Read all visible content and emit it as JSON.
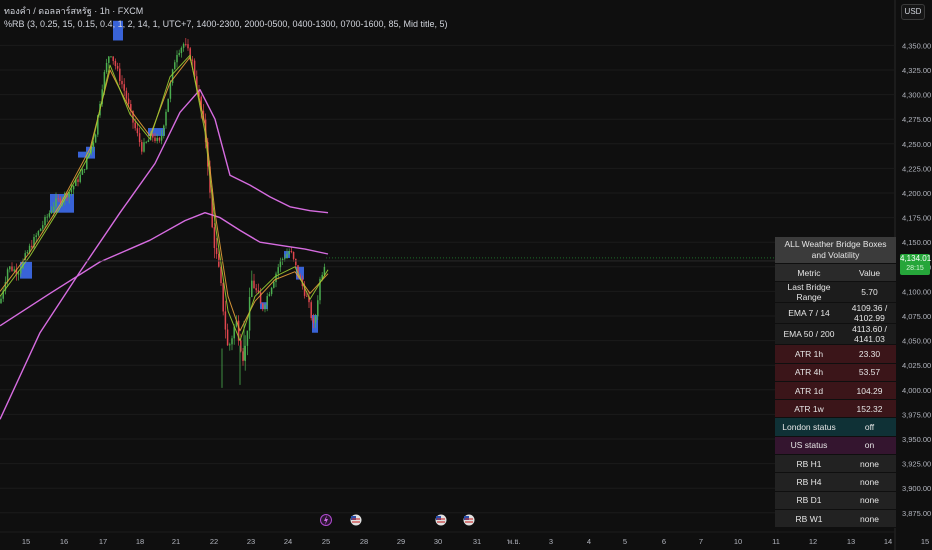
{
  "header": {
    "symbol_line": "ทองคำ / ดอลลาร์สหรัฐ · 1h · FXCM",
    "indicator_line": "%RB (3, 0.25, 15, 0.15, 0.4, 1, 2, 14, 1, UTC+7, 1400-2300, 2000-0500, 0400-1300, 0700-1600, 85, Mid title, 5)"
  },
  "currency_button": "USD",
  "last_price": {
    "value": "4,134.01",
    "countdown": "28:15"
  },
  "chart_data": {
    "type": "candlestick",
    "title": "",
    "y_axis": {
      "min": 3870,
      "max": 4375,
      "ticks": [
        4350,
        4325,
        4300,
        4275,
        4250,
        4225,
        4200,
        4175,
        4150,
        4125,
        4100,
        4075,
        4050,
        4025,
        4000,
        3975,
        3950,
        3925,
        3900,
        3875
      ],
      "tick_labels": [
        "4,350.00",
        "4,325.00",
        "4,300.00",
        "4,275.00",
        "4,250.00",
        "4,225.00",
        "4,200.00",
        "4,175.00",
        "4,150.00",
        "4,125.00",
        "4,100.00",
        "4,075.00",
        "4,050.00",
        "4,025.00",
        "4,000.00",
        "3,975.00",
        "3,950.00",
        "3,925.00",
        "3,900.00",
        "3,875.00"
      ]
    },
    "x_axis": {
      "labels": [
        "15",
        "16",
        "17",
        "18",
        "21",
        "22",
        "23",
        "24",
        "25",
        "28",
        "29",
        "30",
        "31",
        "พ.ย.",
        "3",
        "4",
        "5",
        "6",
        "7",
        "10",
        "11",
        "12",
        "13",
        "14",
        "15"
      ]
    },
    "ohlc_path": [
      [
        0,
        4088
      ],
      [
        8,
        4125
      ],
      [
        18,
        4120
      ],
      [
        30,
        4145
      ],
      [
        45,
        4172
      ],
      [
        55,
        4190
      ],
      [
        70,
        4202
      ],
      [
        82,
        4220
      ],
      [
        95,
        4258
      ],
      [
        103,
        4315
      ],
      [
        110,
        4345
      ],
      [
        118,
        4322
      ],
      [
        125,
        4302
      ],
      [
        132,
        4275
      ],
      [
        142,
        4245
      ],
      [
        152,
        4258
      ],
      [
        160,
        4250
      ],
      [
        168,
        4296
      ],
      [
        176,
        4342
      ],
      [
        184,
        4352
      ],
      [
        192,
        4335
      ],
      [
        200,
        4290
      ],
      [
        207,
        4245
      ],
      [
        212,
        4165
      ],
      [
        220,
        4112
      ],
      [
        228,
        4040
      ],
      [
        236,
        4070
      ],
      [
        244,
        4030
      ],
      [
        252,
        4112
      ],
      [
        262,
        4082
      ],
      [
        270,
        4102
      ],
      [
        280,
        4130
      ],
      [
        290,
        4142
      ],
      [
        300,
        4112
      ],
      [
        308,
        4090
      ],
      [
        314,
        4062
      ],
      [
        320,
        4112
      ],
      [
        326,
        4134
      ]
    ],
    "series": [
      {
        "name": "",
        "color": "#d66ce0",
        "points": [
          [
            0,
            3970
          ],
          [
            40,
            4058
          ],
          [
            80,
            4120
          ],
          [
            120,
            4180
          ],
          [
            155,
            4230
          ],
          [
            180,
            4282
          ],
          [
            200,
            4305
          ],
          [
            215,
            4275
          ],
          [
            230,
            4218
          ],
          [
            250,
            4208
          ],
          [
            270,
            4196
          ],
          [
            290,
            4186
          ],
          [
            310,
            4182
          ],
          [
            328,
            4180
          ]
        ]
      },
      {
        "name": "",
        "color": "#d66ce0",
        "points": [
          [
            0,
            4065
          ],
          [
            50,
            4098
          ],
          [
            100,
            4130
          ],
          [
            150,
            4152
          ],
          [
            185,
            4172
          ],
          [
            205,
            4180
          ],
          [
            220,
            4175
          ],
          [
            240,
            4162
          ],
          [
            260,
            4150
          ],
          [
            285,
            4146
          ],
          [
            305,
            4143
          ],
          [
            328,
            4138
          ]
        ]
      },
      {
        "name": "",
        "color": "#e8a03a",
        "points": [
          [
            0,
            4100
          ],
          [
            30,
            4140
          ],
          [
            60,
            4188
          ],
          [
            90,
            4245
          ],
          [
            110,
            4325
          ],
          [
            130,
            4285
          ],
          [
            150,
            4258
          ],
          [
            170,
            4312
          ],
          [
            190,
            4338
          ],
          [
            205,
            4270
          ],
          [
            215,
            4180
          ],
          [
            228,
            4095
          ],
          [
            240,
            4060
          ],
          [
            255,
            4090
          ],
          [
            275,
            4112
          ],
          [
            295,
            4120
          ],
          [
            310,
            4098
          ],
          [
            328,
            4118
          ]
        ]
      },
      {
        "name": "",
        "color": "#9acd32",
        "points": [
          [
            0,
            4095
          ],
          [
            30,
            4136
          ],
          [
            60,
            4185
          ],
          [
            90,
            4240
          ],
          [
            110,
            4330
          ],
          [
            130,
            4280
          ],
          [
            150,
            4255
          ],
          [
            170,
            4318
          ],
          [
            190,
            4340
          ],
          [
            205,
            4262
          ],
          [
            215,
            4170
          ],
          [
            228,
            4080
          ],
          [
            240,
            4050
          ],
          [
            255,
            4095
          ],
          [
            275,
            4115
          ],
          [
            295,
            4125
          ],
          [
            310,
            4092
          ],
          [
            328,
            4122
          ]
        ]
      }
    ],
    "boxes": [
      {
        "x0": 20,
        "x1": 32,
        "hi": 4130,
        "lo": 4113,
        "color": "#3d6ae8"
      },
      {
        "x0": 50,
        "x1": 74,
        "hi": 4199,
        "lo": 4180,
        "color": "#3d6ae8"
      },
      {
        "x0": 78,
        "x1": 86,
        "hi": 4242,
        "lo": 4236,
        "color": "#3d6ae8"
      },
      {
        "x0": 86,
        "x1": 95,
        "hi": 4247,
        "lo": 4235,
        "color": "#3d6ae8"
      },
      {
        "x0": 113,
        "x1": 123,
        "hi": 4375,
        "lo": 4355,
        "color": "#3d6ae8"
      },
      {
        "x0": 148,
        "x1": 165,
        "hi": 4266,
        "lo": 4258,
        "color": "#3d6ae8"
      },
      {
        "x0": 260,
        "x1": 268,
        "hi": 4089,
        "lo": 4082,
        "color": "#3d6ae8"
      },
      {
        "x0": 284,
        "x1": 290,
        "hi": 4141,
        "lo": 4134,
        "color": "#3d6ae8"
      },
      {
        "x0": 296,
        "x1": 304,
        "hi": 4125,
        "lo": 4112,
        "color": "#3d6ae8"
      },
      {
        "x0": 312,
        "x1": 318,
        "hi": 4076,
        "lo": 4058,
        "color": "#3d6ae8"
      }
    ],
    "event_markers": [
      {
        "x": 326,
        "icon": "lightning-icon"
      },
      {
        "x": 356,
        "icon": "us-flag-icon"
      },
      {
        "x": 441,
        "icon": "us-flag-icon"
      },
      {
        "x": 469,
        "icon": "us-flag-icon"
      }
    ]
  },
  "stats_table": {
    "title": "ALL Weather Bridge Boxes and Volatility",
    "title_lines": [
      "ALL Weather Bridge Boxes",
      "and Volatility"
    ],
    "header": [
      "Metric",
      "Value"
    ],
    "rows": [
      {
        "metric": "Last Bridge Range",
        "value": "5.70",
        "style": "gray"
      },
      {
        "metric": "EMA 7 / 14",
        "value": "4109.36 / 4102.99",
        "style": "gray"
      },
      {
        "metric": "EMA 50 / 200",
        "value": "4113.60 / 4141.03",
        "style": "gray"
      },
      {
        "metric": "ATR 1h",
        "value": "23.30",
        "style": "red"
      },
      {
        "metric": "ATR 4h",
        "value": "53.57",
        "style": "red"
      },
      {
        "metric": "ATR 1d",
        "value": "104.29",
        "style": "red"
      },
      {
        "metric": "ATR 1w",
        "value": "152.32",
        "style": "red"
      },
      {
        "metric": "London status",
        "value": "off",
        "style": "teal"
      },
      {
        "metric": "US status",
        "value": "on",
        "style": "purp"
      },
      {
        "metric": "RB H1",
        "value": "none",
        "style": "dark"
      },
      {
        "metric": "RB H4",
        "value": "none",
        "style": "dark"
      },
      {
        "metric": "RB D1",
        "value": "none",
        "style": "dark"
      },
      {
        "metric": "RB W1",
        "value": "none",
        "style": "dark"
      }
    ]
  },
  "colors": {
    "background": "#0f0f0f",
    "up": "#4caf50",
    "down": "#e0464e",
    "price_line": "#26a63a"
  }
}
